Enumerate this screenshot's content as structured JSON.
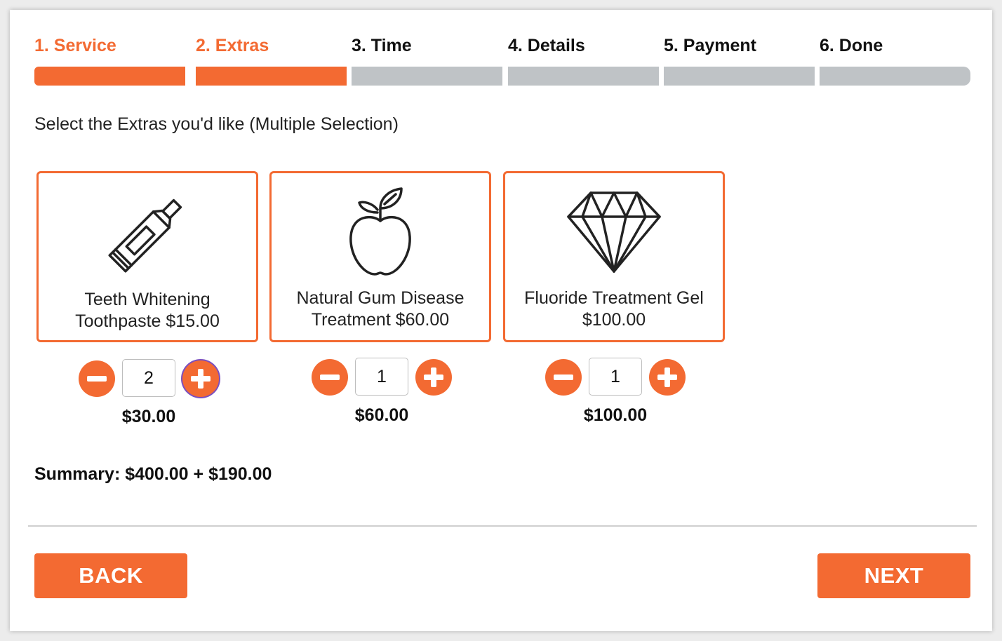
{
  "steps": [
    {
      "label": "1. Service",
      "state": "done"
    },
    {
      "label": "2. Extras",
      "state": "done"
    },
    {
      "label": "3. Time",
      "state": "todo"
    },
    {
      "label": "4. Details",
      "state": "todo"
    },
    {
      "label": "5. Payment",
      "state": "todo"
    },
    {
      "label": "6. Done",
      "state": "todo"
    }
  ],
  "instruction": "Select the Extras you'd like (Multiple Selection)",
  "extras": [
    {
      "title_line1": "Teeth Whitening",
      "title_line2": "Toothpaste $15.00",
      "quantity": "2",
      "subtotal": "$30.00",
      "icon": "toothpaste-tube-icon"
    },
    {
      "title_line1": "Natural Gum Disease",
      "title_line2": "Treatment $60.00",
      "quantity": "1",
      "subtotal": "$60.00",
      "icon": "apple-icon"
    },
    {
      "title_line1": "Fluoride Treatment Gel",
      "title_line2": "$100.00",
      "quantity": "1",
      "subtotal": "$100.00",
      "icon": "diamond-icon"
    }
  ],
  "summary": "Summary: $400.00 + $190.00",
  "buttons": {
    "back": "BACK",
    "next": "NEXT"
  },
  "colors": {
    "accent": "#f36a32",
    "inactive_step": "#bfc3c6"
  }
}
